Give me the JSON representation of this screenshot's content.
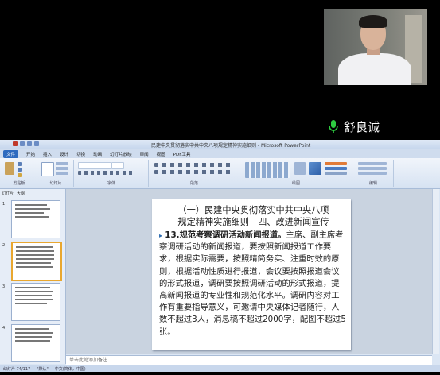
{
  "meeting": {
    "speaker_name": "舒良诚",
    "mic_icon": "microphone-icon"
  },
  "app": {
    "window_title": "民建中央贯彻落实中共中央八项规定精神实施细则 - Microsoft PowerPoint",
    "tabs": [
      "文件",
      "开始",
      "插入",
      "设计",
      "切换",
      "动画",
      "幻灯片放映",
      "审阅",
      "视图",
      "PDF工具"
    ],
    "ribbon_groups": [
      "剪贴板",
      "幻灯片",
      "字体",
      "段落",
      "绘图",
      "编辑"
    ],
    "pane_tabs": [
      "幻灯片",
      "大纲"
    ],
    "thumb_numbers": [
      "1",
      "2",
      "3",
      "4"
    ],
    "notes_placeholder": "单击此处添加备注",
    "status": {
      "slide_info": "幻灯片 74/117",
      "theme": "\"默认\"",
      "language": "中文(简体，中国)"
    }
  },
  "slide": {
    "title_line1": "（一）民建中央贯彻落实中共中央八项",
    "title_line2": "规定精神实施细则　四、改进新闻宣传",
    "item_heading": "13.规范考察调研活动新闻报道。",
    "item_text": "主席、副主席考察调研活动的新闻报道，要按照新闻报道工作要求，根据实际需要，按照精简务实、注重时效的原则，根据活动性质进行报道，会议要按照报道会议的形式报道，调研要按照调研活动的形式报道，提高新闻报道的专业性和规范化水平。调研内容对工作有重要指导意义，可邀请中央媒体记者随行，人数不超过3人，消息稿不超过2000字，配图不超过5张。"
  }
}
